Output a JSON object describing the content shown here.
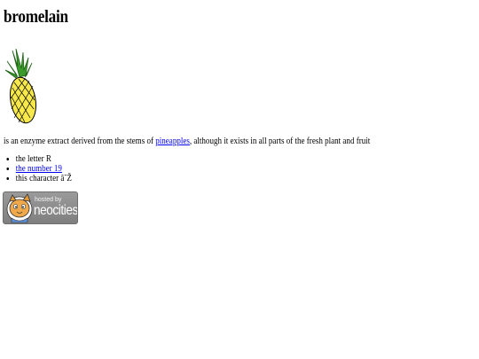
{
  "page": {
    "title": "bromelain"
  },
  "description": {
    "before_link": "is an enzyme extract derived from the stems of ",
    "link_text": "pineapples",
    "after_link": ", although it exists in all parts of the fresh plant and fruit"
  },
  "facts": [
    {
      "text": "the letter R",
      "is_link": false
    },
    {
      "text": "the number 19",
      "is_link": true
    },
    {
      "text": "this character â˜Ž",
      "is_link": false
    }
  ],
  "badge": {
    "hosted_by": "hosted by",
    "brand": "neocities",
    "icon": "neocities-cat-icon"
  },
  "images": {
    "pineapple": "pineapple-icon"
  },
  "colors": {
    "link": "#0000ee",
    "badge_bg": "#8a8a8a",
    "pineapple_body": "#f7e94b",
    "pineapple_leaves": "#2e8b2e"
  }
}
